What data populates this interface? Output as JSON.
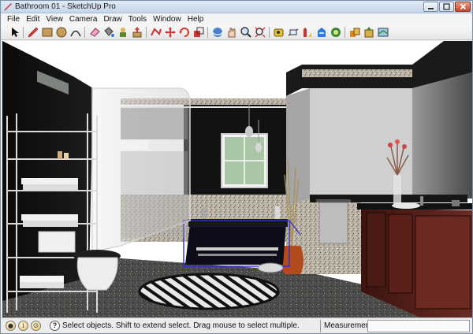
{
  "window": {
    "title": "Bathroom 01 - SketchUp Pro"
  },
  "menu": [
    "File",
    "Edit",
    "View",
    "Camera",
    "Draw",
    "Tools",
    "Window",
    "Help"
  ],
  "toolbar": {
    "tools": [
      "select",
      "pencil-line",
      "rectangle",
      "circle",
      "arc",
      "eraser",
      "paint-bucket",
      "make-component",
      "push-pull",
      "follow-me",
      "move",
      "rotate",
      "scale",
      "offset",
      "orbit",
      "pan",
      "zoom",
      "zoom-extents",
      "tape-measure",
      "dimension",
      "protractor",
      "text",
      "axes",
      "3d-text",
      "section-plane",
      "get-models",
      "share-model",
      "component-tools",
      "styles"
    ]
  },
  "status": {
    "message": "Select objects. Shift to extend select. Drag mouse to select multiple.",
    "measurements_label": "Measurements",
    "measurements_value": ""
  },
  "colors": {
    "selection": "#2b2bd6",
    "wall_dark": "#141414",
    "titlebar": "#c6d6ea"
  }
}
